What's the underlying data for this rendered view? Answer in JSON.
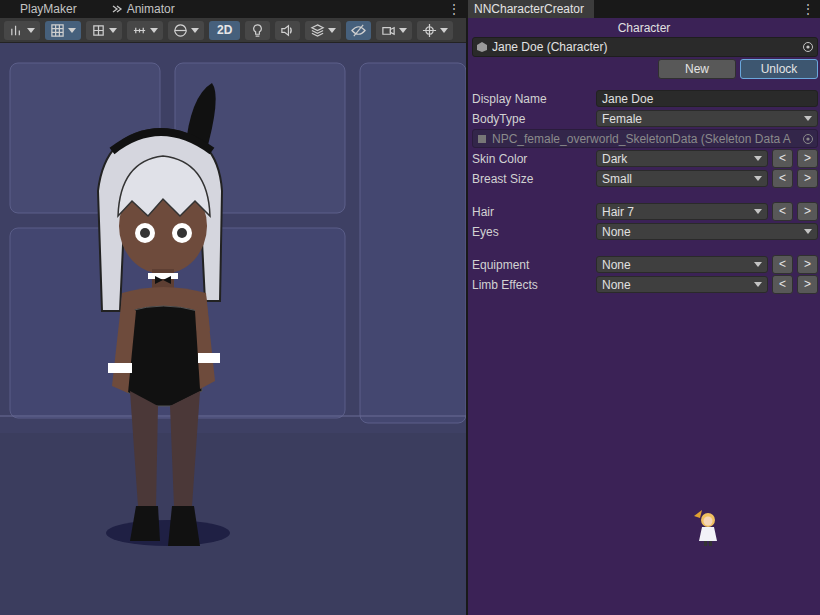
{
  "scene_window": {
    "tabs": [
      {
        "label": "PlayMaker",
        "selected": false
      },
      {
        "label": "Animator",
        "selected": false
      }
    ],
    "menu": "⋮",
    "toolbar": [
      {
        "kind": "icon",
        "selected": false,
        "dropdown": true
      },
      {
        "kind": "icon",
        "selected": true,
        "dropdown": true
      },
      {
        "kind": "icon",
        "selected": false,
        "dropdown": true
      },
      {
        "kind": "icon",
        "selected": false,
        "dropdown": true
      },
      {
        "kind": "icon",
        "selected": false,
        "dropdown": true
      },
      {
        "kind": "text",
        "label": "2D",
        "selected": true,
        "dropdown": false
      },
      {
        "kind": "icon",
        "selected": false,
        "dropdown": false
      },
      {
        "kind": "icon",
        "selected": false,
        "dropdown": false
      },
      {
        "kind": "icon",
        "selected": false,
        "dropdown": true
      },
      {
        "kind": "icon",
        "selected": true,
        "dropdown": false
      },
      {
        "kind": "icon",
        "selected": false,
        "dropdown": true
      },
      {
        "kind": "icon",
        "selected": false,
        "dropdown": true
      }
    ]
  },
  "creator": {
    "tab": {
      "label": "NNCharacterCreator",
      "selected": true
    },
    "menu": "⋮",
    "header": "Character",
    "character_field": "Jane Doe (Character)",
    "buttons": [
      {
        "label": "New",
        "selected": false
      },
      {
        "label": "Unlock",
        "selected": true
      }
    ],
    "groups": [
      [
        {
          "kind": "text",
          "label": "Display Name",
          "value": "Jane Doe"
        },
        {
          "kind": "dropdown",
          "label": "BodyType",
          "value": "Female"
        },
        {
          "kind": "object",
          "value": "NPC_female_overworld_SkeletonData (Skeleton Data A",
          "disabled": true
        },
        {
          "kind": "stepper",
          "label": "Skin Color",
          "value": "Dark",
          "prev": "<",
          "next": ">"
        },
        {
          "kind": "stepper",
          "label": "Breast Size",
          "value": "Small",
          "prev": "<",
          "next": ">"
        }
      ],
      [
        {
          "kind": "stepper",
          "label": "Hair",
          "value": "Hair 7",
          "prev": "<",
          "next": ">"
        },
        {
          "kind": "dropdown",
          "label": "Eyes",
          "value": "None"
        }
      ],
      [
        {
          "kind": "stepper",
          "label": "Equipment",
          "value": "None",
          "prev": "<",
          "next": ">"
        },
        {
          "kind": "stepper",
          "label": "Limb Effects",
          "value": "None",
          "prev": "<",
          "next": ">"
        }
      ]
    ]
  }
}
